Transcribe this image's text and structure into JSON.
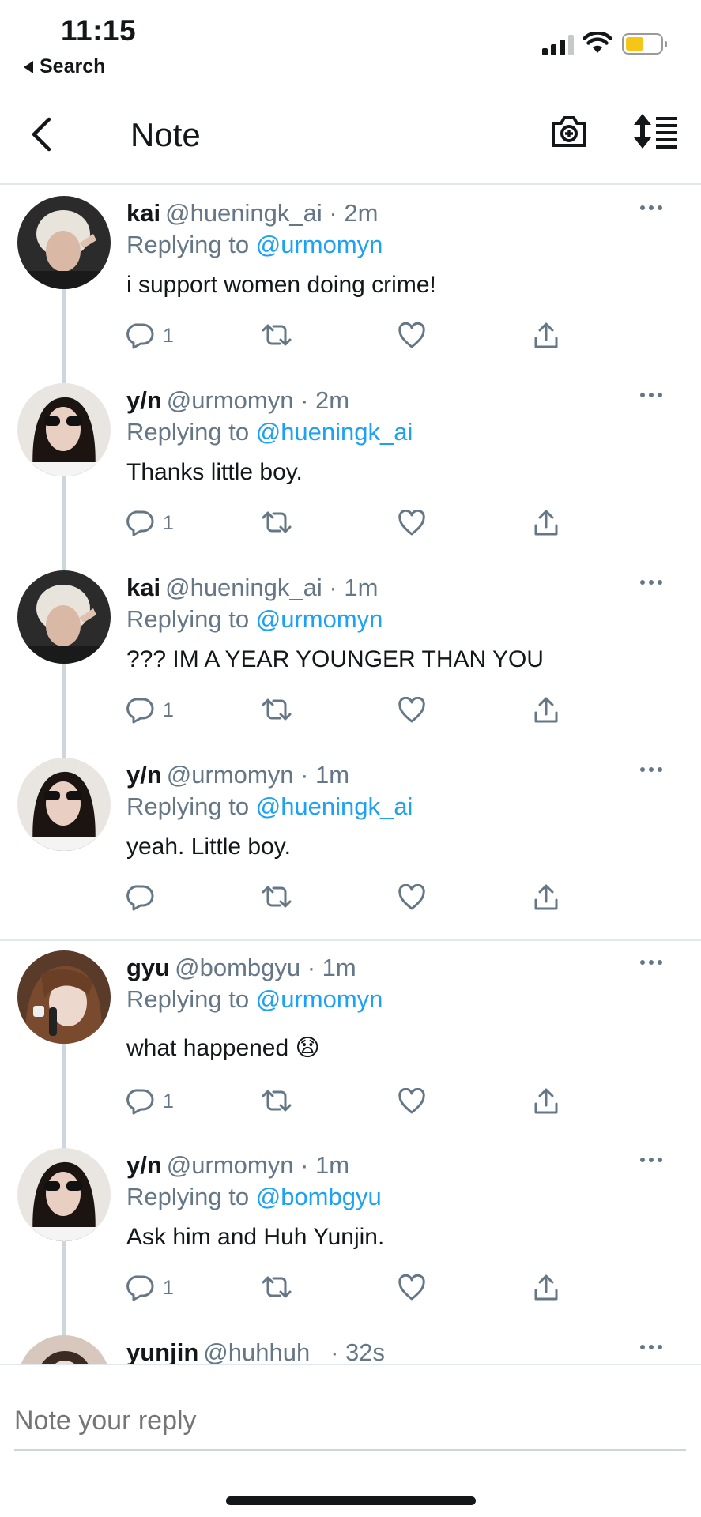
{
  "status_bar": {
    "time": "11:15",
    "back_label": "Search",
    "battery_color": "#f5c518"
  },
  "header": {
    "title": "Note",
    "back_icon": "chevron-left-icon",
    "camera_icon": "camera-plus-icon",
    "sort_icon": "sort-icon"
  },
  "colors": {
    "link": "#1da1f2",
    "muted": "#657786",
    "thread_line": "#ccd6dd"
  },
  "replying_prefix": "Replying to",
  "tweets": [
    {
      "name": "kai",
      "handle": "@hueningk_ai",
      "time": "· 2m",
      "reply_to": "@urmomyn",
      "text": "i support women doing crime!",
      "reply_count": "1"
    },
    {
      "name": "y/n",
      "handle": "@urmomyn",
      "time": "· 2m",
      "reply_to": "@hueningk_ai",
      "text": "Thanks little boy.",
      "reply_count": "1"
    },
    {
      "name": "kai",
      "handle": "@hueningk_ai",
      "time": "· 1m",
      "reply_to": "@urmomyn",
      "text": "??? IM A YEAR YOUNGER THAN YOU",
      "reply_count": "1"
    },
    {
      "name": "y/n",
      "handle": "@urmomyn",
      "time": "· 1m",
      "reply_to": "@hueningk_ai",
      "text": "yeah. Little boy.",
      "reply_count": ""
    },
    {
      "name": "gyu",
      "handle": "@bombgyu",
      "time": "· 1m",
      "reply_to": "@urmomyn",
      "text": "what happened 😧",
      "reply_count": "1"
    },
    {
      "name": "y/n",
      "handle": "@urmomyn",
      "time": "· 1m",
      "reply_to": "@bombgyu",
      "text": "Ask him and Huh Yunjin.",
      "reply_count": "1"
    },
    {
      "name": "yunjin",
      "handle": "@huhhuh_",
      "time": "· 32s"
    }
  ],
  "reply_box": {
    "placeholder": "Note your reply"
  }
}
